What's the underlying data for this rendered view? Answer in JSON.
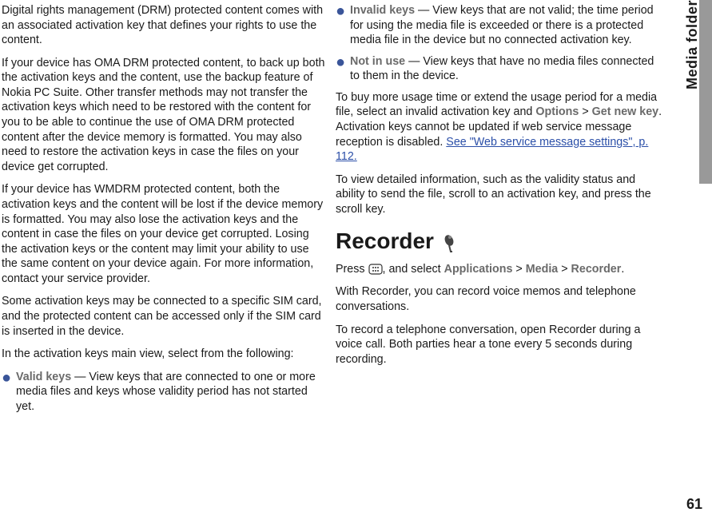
{
  "sideTab": "Media folder",
  "pageNumber": "61",
  "left": {
    "p1": "Digital rights management (DRM) protected content comes with an associated activation key that defines your rights to use the content.",
    "p2": "If your device has OMA DRM protected content, to back up both the activation keys and the content, use the backup feature of Nokia PC Suite. Other transfer methods may not transfer the activation keys which need to be restored with the content for you to be able to continue the use of OMA DRM protected content after the device memory is formatted. You may also need to restore the activation keys in case the files on your device get corrupted.",
    "p3": "If your device has WMDRM protected content, both the activation keys and the content will be lost if the device memory is formatted. You may also lose the activation keys and the content in case the files on your device get corrupted. Losing the activation keys or the content may limit your ability to use the same content on your device again. For more information, contact your service provider.",
    "p4": "Some activation keys may be connected to a specific SIM card, and the protected content can be accessed only if the SIM card is inserted in the device.",
    "p5": "In the activation keys main view, select from the following:",
    "bullet1_label": "Valid keys",
    "bullet1_text": "  — View keys that are connected to one or more media files and keys whose validity period has not started yet."
  },
  "right": {
    "bullet2_label": "Invalid keys",
    "bullet2_text": "  — View keys that are not valid; the time period for using the media file is exceeded or there is a protected media file in the device but no connected activation key.",
    "bullet3_label": "Not in use",
    "bullet3_text": "  — View keys that have no media files connected to them in the device.",
    "p6_part1": "To buy more usage time or extend the usage period for a media file, select an invalid activation key and ",
    "options": "Options",
    "gt": " > ",
    "getNewKey": "Get new key",
    "p6_part2": ". Activation keys cannot be updated if web service message reception is disabled. ",
    "linkText": "See \"Web service message settings\", p. 112.",
    "p7": "To view detailed information, such as the validity status and ability to send the file, scroll to an activation key, and press the scroll key.",
    "recorderHeading": "Recorder",
    "p8_part1": "Press  ",
    "p8_part2": ", and select ",
    "applications": "Applications",
    "media": "Media",
    "recorder": "Recorder",
    "period": ".",
    "p9": "With Recorder, you can record voice memos and telephone conversations.",
    "p10": "To record a telephone conversation, open Recorder during a voice call. Both parties hear a tone every 5 seconds during recording."
  }
}
